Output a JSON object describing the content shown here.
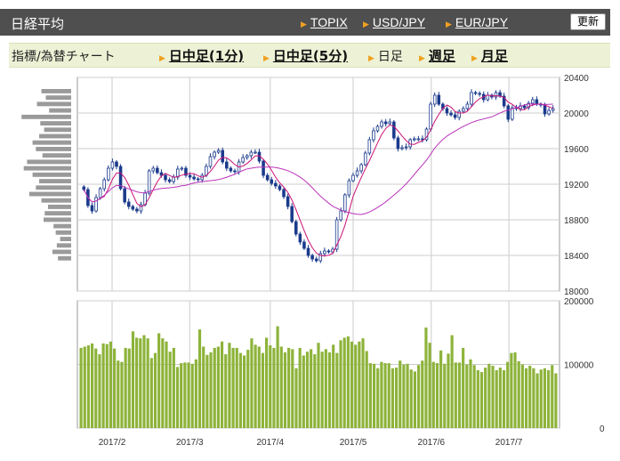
{
  "header": {
    "title": "日経平均",
    "links": [
      "TOPIX",
      "USD/JPY",
      "EUR/JPY"
    ],
    "refresh_label": "更新"
  },
  "subnav": {
    "label": "指標/為替チャート",
    "links": [
      "日中足(1分)",
      "日中足(5分)"
    ],
    "current": "日足",
    "links2": [
      "週足",
      "月足"
    ]
  },
  "colors": {
    "candle_up": "#ffffff",
    "candle_down": "#1a3a8c",
    "candle_border": "#1a3a8c",
    "ma_short": "#cc1177",
    "ma_long": "#bb33bb",
    "volume_bar": "#8db33a",
    "volume_profile": "#9a9a9a",
    "grid": "#cccccc",
    "header_bg": "#4f4f4f",
    "subnav_bg": "#edf2d6"
  },
  "chart_data": [
    {
      "type": "candlestick",
      "title": "日経平均",
      "y_ticks": [
        18000,
        18400,
        18800,
        19200,
        19600,
        20000,
        20400
      ],
      "ylim": [
        18000,
        20400
      ],
      "x_ticks": [
        "2017/2",
        "2017/3",
        "2017/4",
        "2017/5",
        "2017/6",
        "2017/7"
      ],
      "grid": true,
      "close": [
        19140,
        18960,
        18900,
        19050,
        19150,
        19250,
        19380,
        19450,
        19400,
        19150,
        19000,
        18950,
        18920,
        18900,
        18970,
        19100,
        19350,
        19380,
        19330,
        19300,
        19250,
        19230,
        19280,
        19370,
        19380,
        19300,
        19280,
        19260,
        19250,
        19300,
        19400,
        19510,
        19560,
        19580,
        19450,
        19380,
        19350,
        19340,
        19450,
        19500,
        19520,
        19560,
        19560,
        19460,
        19300,
        19250,
        19210,
        19180,
        19140,
        19060,
        18950,
        18780,
        18640,
        18550,
        18480,
        18400,
        18360,
        18340,
        18420,
        18450,
        18440,
        18470,
        18800,
        18900,
        19080,
        19240,
        19300,
        19350,
        19420,
        19550,
        19700,
        19800,
        19850,
        19900,
        19880,
        19900,
        19720,
        19600,
        19610,
        19620,
        19700,
        19710,
        19710,
        19700,
        19820,
        20100,
        20200,
        20100,
        20050,
        20000,
        19980,
        19950,
        20020,
        20050,
        20100,
        20230,
        20220,
        20210,
        20150,
        20200,
        20180,
        20230,
        20190,
        20080,
        19930,
        20060,
        20050,
        20080,
        20060,
        20110,
        20150,
        20100,
        20090,
        19990,
        20030,
        20050
      ],
      "volume_ticks": [
        0,
        100000,
        200000
      ],
      "volume_ylim": [
        0,
        200000
      ],
      "volume": [
        126000,
        128000,
        130000,
        133000,
        125000,
        116000,
        133000,
        132000,
        136000,
        125000,
        106000,
        104000,
        126000,
        125000,
        152000,
        142000,
        141000,
        146000,
        141000,
        110000,
        118000,
        149000,
        141000,
        136000,
        120000,
        126000,
        96000,
        102000,
        103000,
        103000,
        101000,
        108000,
        155000,
        128000,
        115000,
        119000,
        126000,
        128000,
        136000,
        116000,
        134000,
        126000,
        126000,
        118000,
        114000,
        123000,
        141000,
        131000,
        128000,
        118000,
        142000,
        130000,
        126000,
        160000,
        128000,
        119000,
        126000,
        124000,
        94000,
        126000,
        114000,
        120000,
        124000,
        116000,
        134000,
        120000,
        124000,
        119000,
        131000,
        118000,
        138000,
        142000,
        144000,
        136000,
        131000,
        136000,
        141000,
        121000,
        102000,
        101000,
        94000,
        104000,
        102000,
        102000,
        94000,
        95000,
        106000,
        100000,
        101000,
        92000,
        89000,
        99000,
        106000,
        158000,
        134000,
        104000,
        102000,
        122000,
        101000,
        117000,
        146000,
        103000,
        103000,
        126000,
        100000,
        108000,
        99000,
        91000,
        88000,
        95000,
        101000,
        98000,
        91000,
        95000,
        91000,
        104000,
        118000,
        119000,
        105000,
        100000,
        94000,
        98000,
        94000,
        86000,
        92000,
        94000,
        91000,
        99000,
        86000
      ],
      "price_profile": [
        0.54,
        0.46,
        0.62,
        0.4,
        0.9,
        0.56,
        0.49,
        0.58,
        0.7,
        0.64,
        0.52,
        0.8,
        0.86,
        0.7,
        0.58,
        0.64,
        0.76,
        0.54,
        0.42,
        0.48,
        0.5,
        0.32,
        0.28,
        0.2,
        0.26,
        0.34,
        0.24
      ]
    }
  ]
}
